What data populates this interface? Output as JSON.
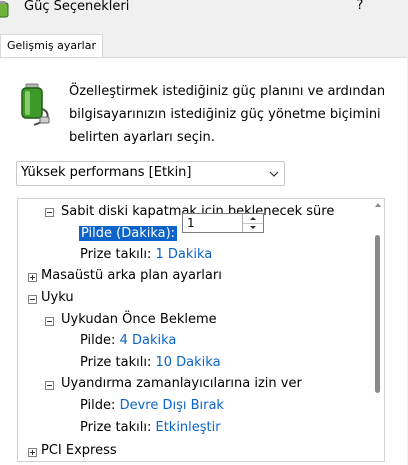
{
  "window": {
    "title": "Güç Seçenekleri",
    "help": "?"
  },
  "tabs": [
    {
      "label": "Gelişmiş ayarlar"
    }
  ],
  "description": "Özelleştirmek istediğiniz güç planını ve ardından bilgisayarınızın istediğiniz güç yönetme biçimini belirten ayarları seçin.",
  "plan_select": {
    "value": "Yüksek performans [Etkin]"
  },
  "tree": {
    "disk": {
      "label": "Sabit diski kapatmak için beklenecek süre",
      "setting_label": "Pilde (Dakika):",
      "setting_value": "1",
      "plugged_label": "Prize takılı:",
      "plugged_value": "1 Dakika"
    },
    "desktop": {
      "label": "Masaüstü arka plan ayarları"
    },
    "sleep": {
      "label": "Uyku",
      "before": {
        "label": "Uykudan Önce Bekleme",
        "battery_label": "Pilde:",
        "battery_value": "4 Dakika",
        "plugged_label": "Prize takılı:",
        "plugged_value": "10 Dakika"
      },
      "wake": {
        "label": "Uyandırma zamanlayıcılarına izin ver",
        "battery_label": "Pilde:",
        "battery_value": "Devre Dışı Bırak",
        "plugged_label": "Prize takılı:",
        "plugged_value": "Etkinleştir"
      }
    },
    "pci": {
      "label": "PCI Express"
    }
  }
}
